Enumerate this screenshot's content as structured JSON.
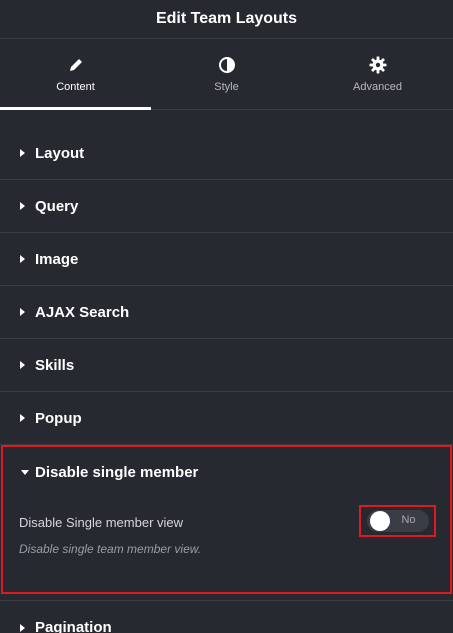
{
  "header": {
    "title": "Edit Team Layouts"
  },
  "tabs": [
    {
      "label": "Content",
      "icon": "pencil-icon",
      "active": true
    },
    {
      "label": "Style",
      "icon": "contrast-icon",
      "active": false
    },
    {
      "label": "Advanced",
      "icon": "gear-icon",
      "active": false
    }
  ],
  "sections": [
    {
      "label": "Layout"
    },
    {
      "label": "Query"
    },
    {
      "label": "Image"
    },
    {
      "label": "AJAX Search"
    },
    {
      "label": "Skills"
    },
    {
      "label": "Popup"
    }
  ],
  "open_section": {
    "label": "Disable single member",
    "control_label": "Disable Single member view",
    "toggle_state": "No",
    "description": "Disable single team member view."
  },
  "after_sections": [
    {
      "label": "Pagination"
    }
  ],
  "colors": {
    "background": "#26292f",
    "highlight": "#e0191f",
    "divider": "#3a3d42"
  }
}
